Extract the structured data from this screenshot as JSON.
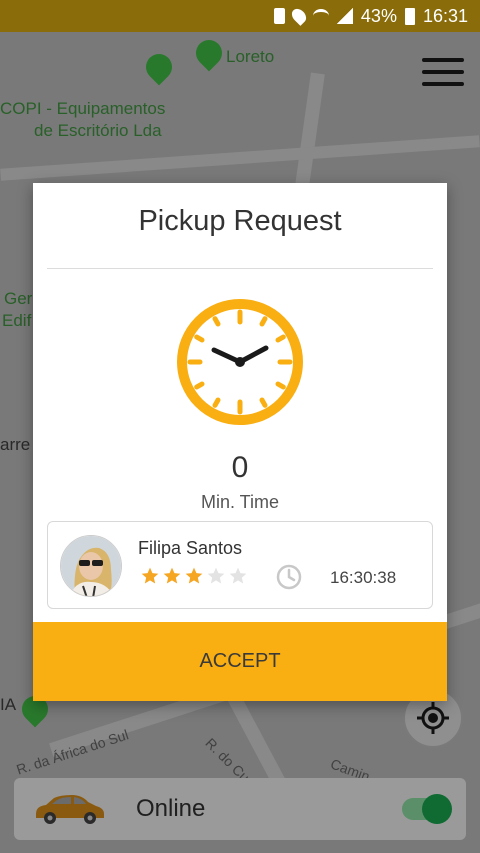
{
  "status_bar": {
    "battery_percent": "43%",
    "time": "16:31"
  },
  "map": {
    "labels": {
      "loreto": "Loreto",
      "copi_line1": "COPI - Equipamentos",
      "copi_line2": "de Escritório Lda",
      "ger": "Ger",
      "edif": "Edif",
      "arre": "arre",
      "ia": "IA"
    },
    "streets": {
      "africa_do_sul": "R. da África do Sul",
      "do_cu": "R. do Cu",
      "camin": "Camin"
    }
  },
  "dialog": {
    "title": "Pickup Request",
    "min_time_value": "0",
    "min_time_label": "Min. Time",
    "rider": {
      "name": "Filipa Santos",
      "rating": 3,
      "rating_max": 5,
      "request_time": "16:30:38"
    },
    "accept_label": "ACCEPT"
  },
  "bottom_bar": {
    "status_label": "Online",
    "online": true
  },
  "colors": {
    "accent": "#f9ae12",
    "star_on": "#f5a623",
    "star_off": "#e3e3e3",
    "toggle_on": "#0f6b32"
  }
}
